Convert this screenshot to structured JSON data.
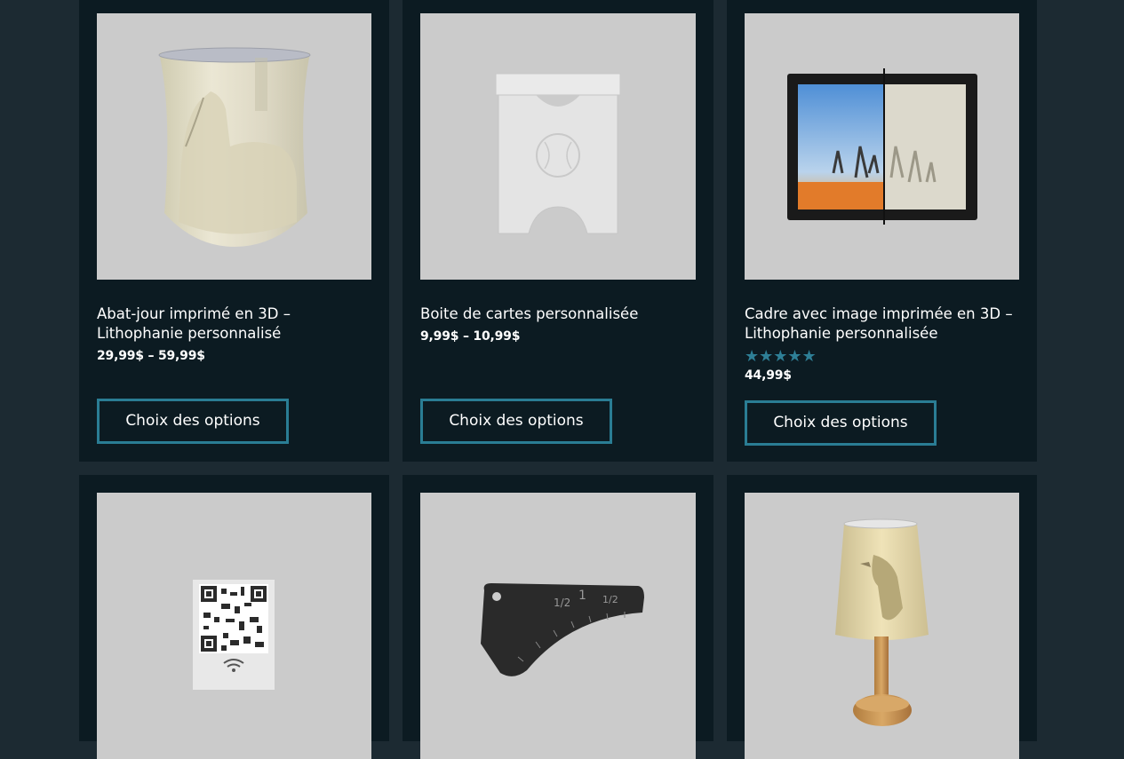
{
  "products": [
    {
      "title": "Abat-jour imprimé en 3D – Lithophanie personnalisé",
      "price": "29,99$ – 59,99$",
      "button": "Choix des options",
      "image": "horse-lampshade"
    },
    {
      "title": "Boite de cartes personnalisée",
      "price": "9,99$ – 10,99$",
      "button": "Choix des options",
      "image": "card-box"
    },
    {
      "title": "Cadre avec image imprimée en 3D – Lithophanie personnalisée",
      "rating": 5,
      "rating_stars": "★★★★★",
      "price": "44,99$",
      "button": "Choix des options",
      "image": "photo-frame"
    },
    {
      "image": "qr-wifi-card"
    },
    {
      "image": "sewing-ruler"
    },
    {
      "image": "bird-lamp"
    }
  ],
  "colors": {
    "page_bg": "#1c2a32",
    "card_bg": "#0c1b22",
    "accent": "#2a7d94",
    "image_bg": "#cbcbcb"
  }
}
